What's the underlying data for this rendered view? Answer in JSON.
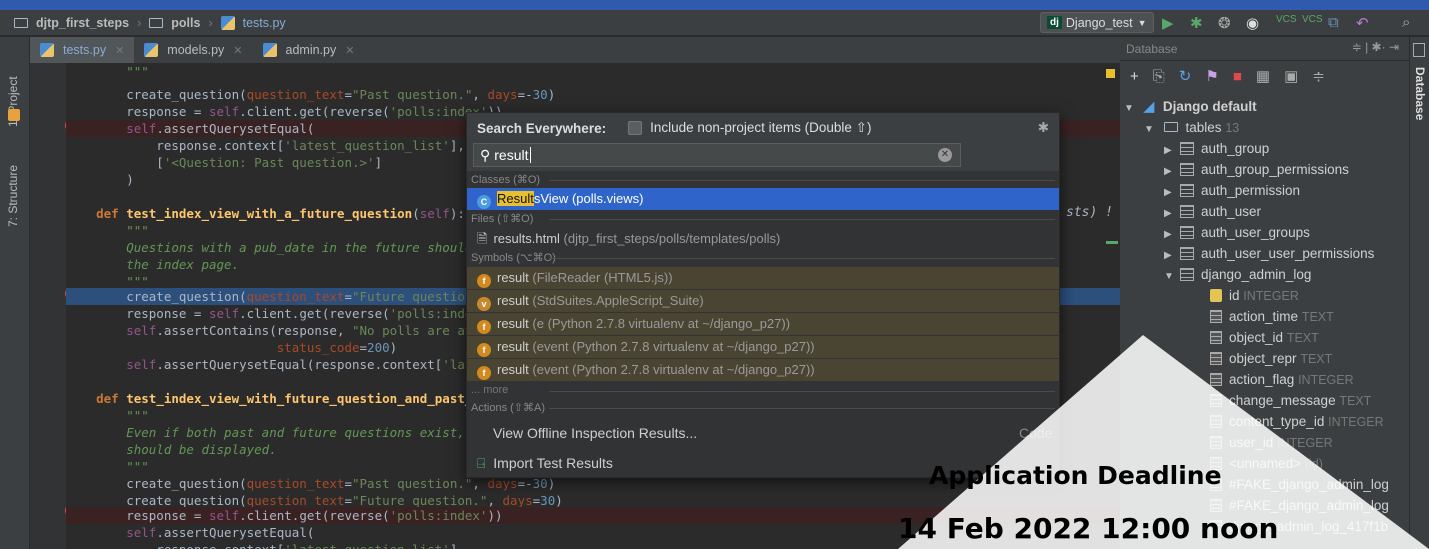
{
  "nav": {
    "breadcrumbs": [
      "djtp_first_steps",
      "polls",
      "tests.py"
    ],
    "run_config": "Django_test",
    "run_config_badge": "dj",
    "icons": [
      "run-icon",
      "debug-icon",
      "coverage-icon",
      "profile-icon",
      "vcs-update-icon",
      "vcs-commit-icon",
      "structure-icon",
      "revert-icon",
      "search-icon"
    ]
  },
  "sidebar": {
    "project": "1: Project",
    "structure": "7: Structure"
  },
  "right_sidebar": {
    "database": "Database"
  },
  "tabs": [
    {
      "label": "tests.py",
      "active": true
    },
    {
      "label": "models.py",
      "active": false
    },
    {
      "label": "admin.py",
      "active": false
    }
  ],
  "code_lines": [
    "        \"\"\"",
    "        create_question(question_text=\"Past question.\", days=-30)",
    "        response = self.client.get(reverse('polls:index'))",
    "        self.assertQuerysetEqual(",
    "            response.context['latest_question_list'],",
    "            ['<Question: Past question.>']",
    "        )",
    "",
    "    def test_index_view_with_a_future_question(self):",
    "        \"\"\"",
    "        Questions with a pub_date in the future should not be displayed on",
    "        the index page.",
    "        \"\"\"",
    "        create_question(question_text=\"Future question.\", days=30)",
    "        response = self.client.get(reverse('polls:index'))",
    "        self.assertContains(response, \"No polls are available.\",",
    "                            status_code=200)",
    "        self.assertQuerysetEqual(response.context['latest_question_list'], [])",
    "",
    "    def test_index_view_with_future_question_and_past_question(self):",
    "        \"\"\"",
    "        Even if both past and future questions exist, only past questions",
    "        should be displayed.",
    "        \"\"\"",
    "        create_question(question_text=\"Past question.\", days=-30)",
    "        create_question(question_text=\"Future question.\", days=30)",
    "        response = self.client.get(reverse('polls:index'))",
    "        self.assertQuerysetEqual(",
    "            response.context['latest_question_list'],"
  ],
  "editor_right_fragment": "sts) !",
  "search_popup": {
    "title": "Search Everywhere:",
    "include_label": "Include non-project items (Double ⇧)",
    "query": "result",
    "sections": {
      "classes": "Classes (⌘O)",
      "files": "Files (⇧⌘O)",
      "symbols": "Symbols (⌥⌘O)",
      "actions": "Actions (⇧⌘A)"
    },
    "class_result": {
      "match": "Result",
      "rest": "sView",
      "detail": "(polls.views)",
      "badge": "C"
    },
    "file_result": {
      "name": "results.html",
      "detail": "(djtp_first_steps/polls/templates/polls)"
    },
    "symbols": [
      {
        "badge": "f",
        "name": "result",
        "detail": "(FileReader (HTML5.js))"
      },
      {
        "badge": "v",
        "name": "result",
        "detail": "(StdSuites.AppleScript_Suite)"
      },
      {
        "badge": "f",
        "name": "result",
        "detail": "(e (Python 2.7.8 virtualenv at ~/django_p27))"
      },
      {
        "badge": "f",
        "name": "result",
        "detail": "(event (Python 2.7.8 virtualenv at ~/django_p27))"
      },
      {
        "badge": "f",
        "name": "result",
        "detail": "(event (Python 2.7.8 virtualenv at ~/django_p27))"
      }
    ],
    "more": "... more",
    "actions": [
      {
        "label": "View Offline Inspection Results...",
        "hint": "Code"
      },
      {
        "label": "Import Test Results",
        "hint": ""
      }
    ]
  },
  "database": {
    "title": "Database",
    "root": "Django default",
    "tables_label": "tables",
    "tables_count": "13",
    "tables": [
      "auth_group",
      "auth_group_permissions",
      "auth_permission",
      "auth_user",
      "auth_user_groups",
      "auth_user_user_permissions",
      "django_admin_log"
    ],
    "columns": [
      {
        "name": "id",
        "type": "INTEGER",
        "key": true
      },
      {
        "name": "action_time",
        "type": "TEXT"
      },
      {
        "name": "object_id",
        "type": "TEXT"
      },
      {
        "name": "object_repr",
        "type": "TEXT"
      },
      {
        "name": "action_flag",
        "type": "INTEGER"
      },
      {
        "name": "change_message",
        "type": "TEXT"
      },
      {
        "name": "content_type_id",
        "type": "INTEGER"
      },
      {
        "name": "user_id",
        "type": "INTEGER"
      },
      {
        "name": "<unnamed>",
        "type": "(id)"
      },
      {
        "name": "#FAKE_django_admin_log",
        "type": ""
      },
      {
        "name": "#FAKE_django_admin_log",
        "type": ""
      },
      {
        "name": "django_admin_log_417f1b",
        "type": ""
      }
    ]
  },
  "watermark": {
    "line1": "Application Deadline",
    "line2": "14 Feb 2022 12:00 noon"
  }
}
